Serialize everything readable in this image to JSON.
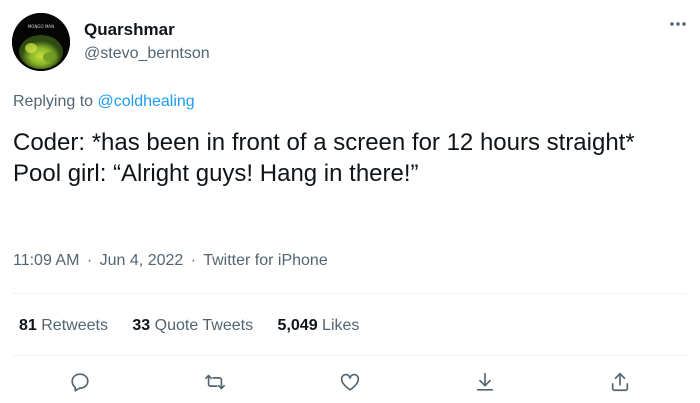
{
  "author": {
    "display_name": "Quarshmar",
    "handle": "@stevo_berntson",
    "avatar_caption": "MONGO MAN"
  },
  "menu_icon": "more-horizontal-icon",
  "reply_context": {
    "prefix": "Replying to",
    "mention": "@coldhealing"
  },
  "tweet": {
    "lines": [
      "Coder: *has been in front of a screen for 12 hours straight*",
      "Pool girl: “Alright guys! Hang in there!”"
    ]
  },
  "meta": {
    "time": "11:09 AM",
    "date": "Jun 4, 2022",
    "source": "Twitter for iPhone",
    "separator": "·"
  },
  "stats": [
    {
      "count": "81",
      "label": "Retweets"
    },
    {
      "count": "33",
      "label": "Quote Tweets"
    },
    {
      "count": "5,049",
      "label": "Likes"
    }
  ],
  "actions": [
    "reply-icon",
    "retweet-icon",
    "like-icon",
    "bookmark-icon",
    "share-icon"
  ],
  "colors": {
    "text": "#0f1419",
    "secondary": "#536471",
    "accent": "#1d9bf0",
    "divider": "#eff3f4"
  }
}
